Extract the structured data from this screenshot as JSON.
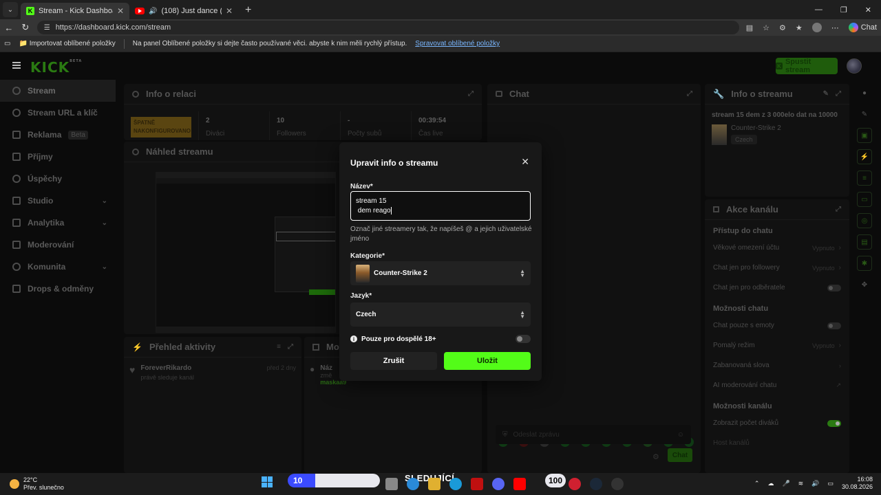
{
  "browser": {
    "tabs": [
      {
        "title": "Stream - Kick Dashboard",
        "active": true
      },
      {
        "title": "(108) Just dance (sped up) - Y",
        "active": false
      }
    ],
    "url": "https://dashboard.kick.com/stream",
    "favorites_import": "Importovat oblíbené položky",
    "favorites_message": "Na panel Oblíbené položky si dejte často používané věci. abyste k nim měli rychlý přístup.",
    "favorites_link": "Spravovat oblíbené položky",
    "chat_label": "Chat"
  },
  "header": {
    "logo": "KICK",
    "logo_sup": "BETA",
    "start_stream": "Spustit stream"
  },
  "sidebar": {
    "items": [
      {
        "label": "Stream"
      },
      {
        "label": "Stream URL a klíč"
      },
      {
        "label": "Reklama",
        "badge": "Beta"
      },
      {
        "label": "Příjmy"
      },
      {
        "label": "Úspěchy"
      },
      {
        "label": "Studio"
      },
      {
        "label": "Analytika"
      },
      {
        "label": "Moderování"
      },
      {
        "label": "Komunita"
      },
      {
        "label": "Drops & odměny"
      }
    ]
  },
  "session": {
    "title": "Info o relaci",
    "status_tag": "ŠPATNĚ NAKONFIGUROVANO",
    "stats": [
      {
        "value": "2",
        "label": "Diváci"
      },
      {
        "value": "10",
        "label": "Followers"
      },
      {
        "value": "-",
        "label": "Počty subů"
      },
      {
        "value": "00:39:54",
        "label": "Čas live"
      }
    ]
  },
  "preview": {
    "title": "Náhled streamu"
  },
  "activity": {
    "title": "Přehled aktivity",
    "item_user": "ForeverRikardo",
    "item_text": "právě sleduje kanál",
    "item_time": "před 2 dny"
  },
  "mod_panel": {
    "title": "Mo",
    "item_title": "Náz",
    "item_sub": "změ",
    "item_user": "maskaa9"
  },
  "chat": {
    "title": "Chat",
    "input_placeholder": "Odeslat zprávu",
    "send_label": "Chat"
  },
  "stream_info": {
    "title": "Info o streamu",
    "stream_title": "stream 15 dem z 3 000elo dat na 10000",
    "category": "Counter-Strike 2",
    "language": "Czech"
  },
  "channel_actions": {
    "title": "Akce kanálu",
    "sections": [
      {
        "heading": "Přístup do chatu",
        "items": [
          {
            "label": "Věkové omezení účtu",
            "value": "Vypnuto"
          },
          {
            "label": "Chat jen pro followery",
            "value": "Vypnuto"
          },
          {
            "label": "Chat jen pro odběratele",
            "toggle": "off"
          }
        ]
      },
      {
        "heading": "Možnosti chatu",
        "items": [
          {
            "label": "Chat pouze s emoty",
            "toggle": "off"
          },
          {
            "label": "Pomalý režim",
            "value": "Vypnuto"
          },
          {
            "label": "Zabanovaná slova",
            "value": ""
          },
          {
            "label": "AI moderování chatu",
            "value": ""
          }
        ]
      },
      {
        "heading": "Možnosti kanálu",
        "items": [
          {
            "label": "Zobrazit počet diváků",
            "toggle": "on"
          },
          {
            "label": "Host kanálů",
            "value": ""
          }
        ]
      }
    ]
  },
  "modal": {
    "title": "Upravit info o streamu",
    "name_label": "Název*",
    "name_value_line1": "stream 15",
    "name_value_line2": " dem reago",
    "hint": "Označ jiné streamery tak, že napíšeš @ a jejich uživatelské jméno",
    "category_label": "Kategorie*",
    "category_value": "Counter-Strike 2",
    "language_label": "Jazyk*",
    "language_value": "Czech",
    "adult_label": "Pouze pro dospělé 18+",
    "adult_toggle": "off",
    "cancel": "Zrušit",
    "save": "Uložit"
  },
  "taskbar": {
    "temp": "22°C",
    "weather": "Přev. slunečno",
    "overlay_num": "10",
    "overlay_text": "SLEDUJÍCÍ",
    "overlay_num2": "100",
    "time": "16:08",
    "date": "30.08.2026"
  },
  "colors": {
    "accent": "#53fc18",
    "modal_bg": "#181818",
    "app_bg": "#0b0b0b"
  }
}
